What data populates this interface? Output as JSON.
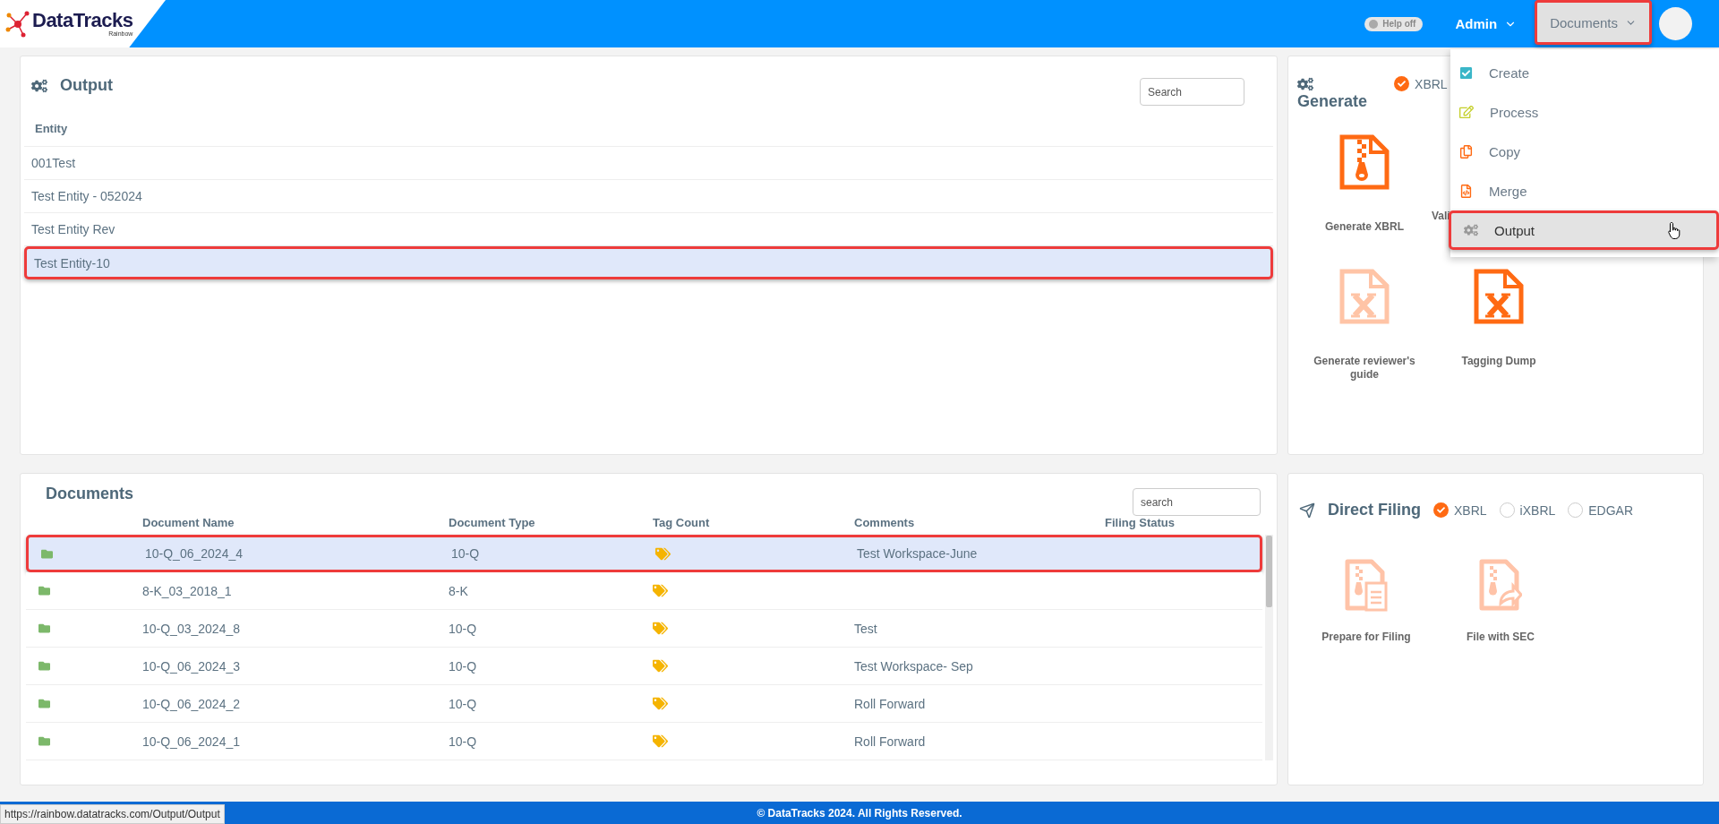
{
  "header": {
    "logo": {
      "name": "DataTracks",
      "sub": "Rainbow"
    },
    "help_toggle": {
      "label": "Help off",
      "on": false
    },
    "user_menu": "Admin",
    "nav_menu": {
      "label": "Documents",
      "highlighted": true,
      "expanded": true,
      "items": [
        {
          "label": "Create",
          "kind": "create",
          "selected": false
        },
        {
          "label": "Process",
          "kind": "process",
          "selected": false
        },
        {
          "label": "Copy",
          "kind": "copy",
          "selected": false
        },
        {
          "label": "Merge",
          "kind": "merge",
          "selected": false
        },
        {
          "label": "Output",
          "kind": "output",
          "selected": true
        }
      ]
    }
  },
  "output_panel": {
    "title": "Output",
    "search": {
      "placeholder": "Search"
    },
    "column": "Entity",
    "rows": [
      {
        "name": "001Test",
        "selected": false
      },
      {
        "name": "Test Entity - 052024",
        "selected": false
      },
      {
        "name": "Test Entity Rev",
        "selected": false
      },
      {
        "name": "Test Entity-10",
        "selected": true
      }
    ]
  },
  "generate_panel": {
    "title": "Generate",
    "format": {
      "label": "XBRL",
      "checked": true
    },
    "actions": [
      {
        "label": "Generate XBRL",
        "kind": "zip",
        "enabled": true
      },
      {
        "label": "Vali",
        "kind": "text"
      },
      {
        "label": "Generate reviewer's guide",
        "kind": "excel",
        "enabled": false
      },
      {
        "label": "Tagging Dump",
        "kind": "excel",
        "enabled": true
      }
    ]
  },
  "documents_panel": {
    "title": "Documents",
    "search": {
      "placeholder": "search"
    },
    "columns": [
      "Document Name",
      "Document Type",
      "Tag Count",
      "Comments",
      "Filing Status"
    ],
    "rows": [
      {
        "name": "10-Q_06_2024_4",
        "type": "10-Q",
        "comment": "Test Workspace-June",
        "selected": true
      },
      {
        "name": "8-K_03_2018_1",
        "type": "8-K",
        "comment": "",
        "selected": false
      },
      {
        "name": "10-Q_03_2024_8",
        "type": "10-Q",
        "comment": "Test",
        "selected": false
      },
      {
        "name": "10-Q_06_2024_3",
        "type": "10-Q",
        "comment": "Test Workspace- Sep",
        "selected": false
      },
      {
        "name": "10-Q_06_2024_2",
        "type": "10-Q",
        "comment": "Roll Forward",
        "selected": false
      },
      {
        "name": "10-Q_06_2024_1",
        "type": "10-Q",
        "comment": "Roll Forward",
        "selected": false
      }
    ]
  },
  "direct_filing_panel": {
    "title": "Direct Filing",
    "formats": [
      {
        "label": "XBRL",
        "selected": true
      },
      {
        "label": "iXBRL",
        "selected": false
      },
      {
        "label": "EDGAR",
        "selected": false
      }
    ],
    "actions": [
      {
        "label": "Prepare for Filing",
        "kind": "prepare",
        "enabled": false
      },
      {
        "label": "File with SEC",
        "kind": "send",
        "enabled": false
      }
    ]
  },
  "footer": {
    "copyright": "© DataTracks 2024. All Rights Reserved.",
    "status_url": "https://rainbow.datatracks.com/Output/Output"
  }
}
